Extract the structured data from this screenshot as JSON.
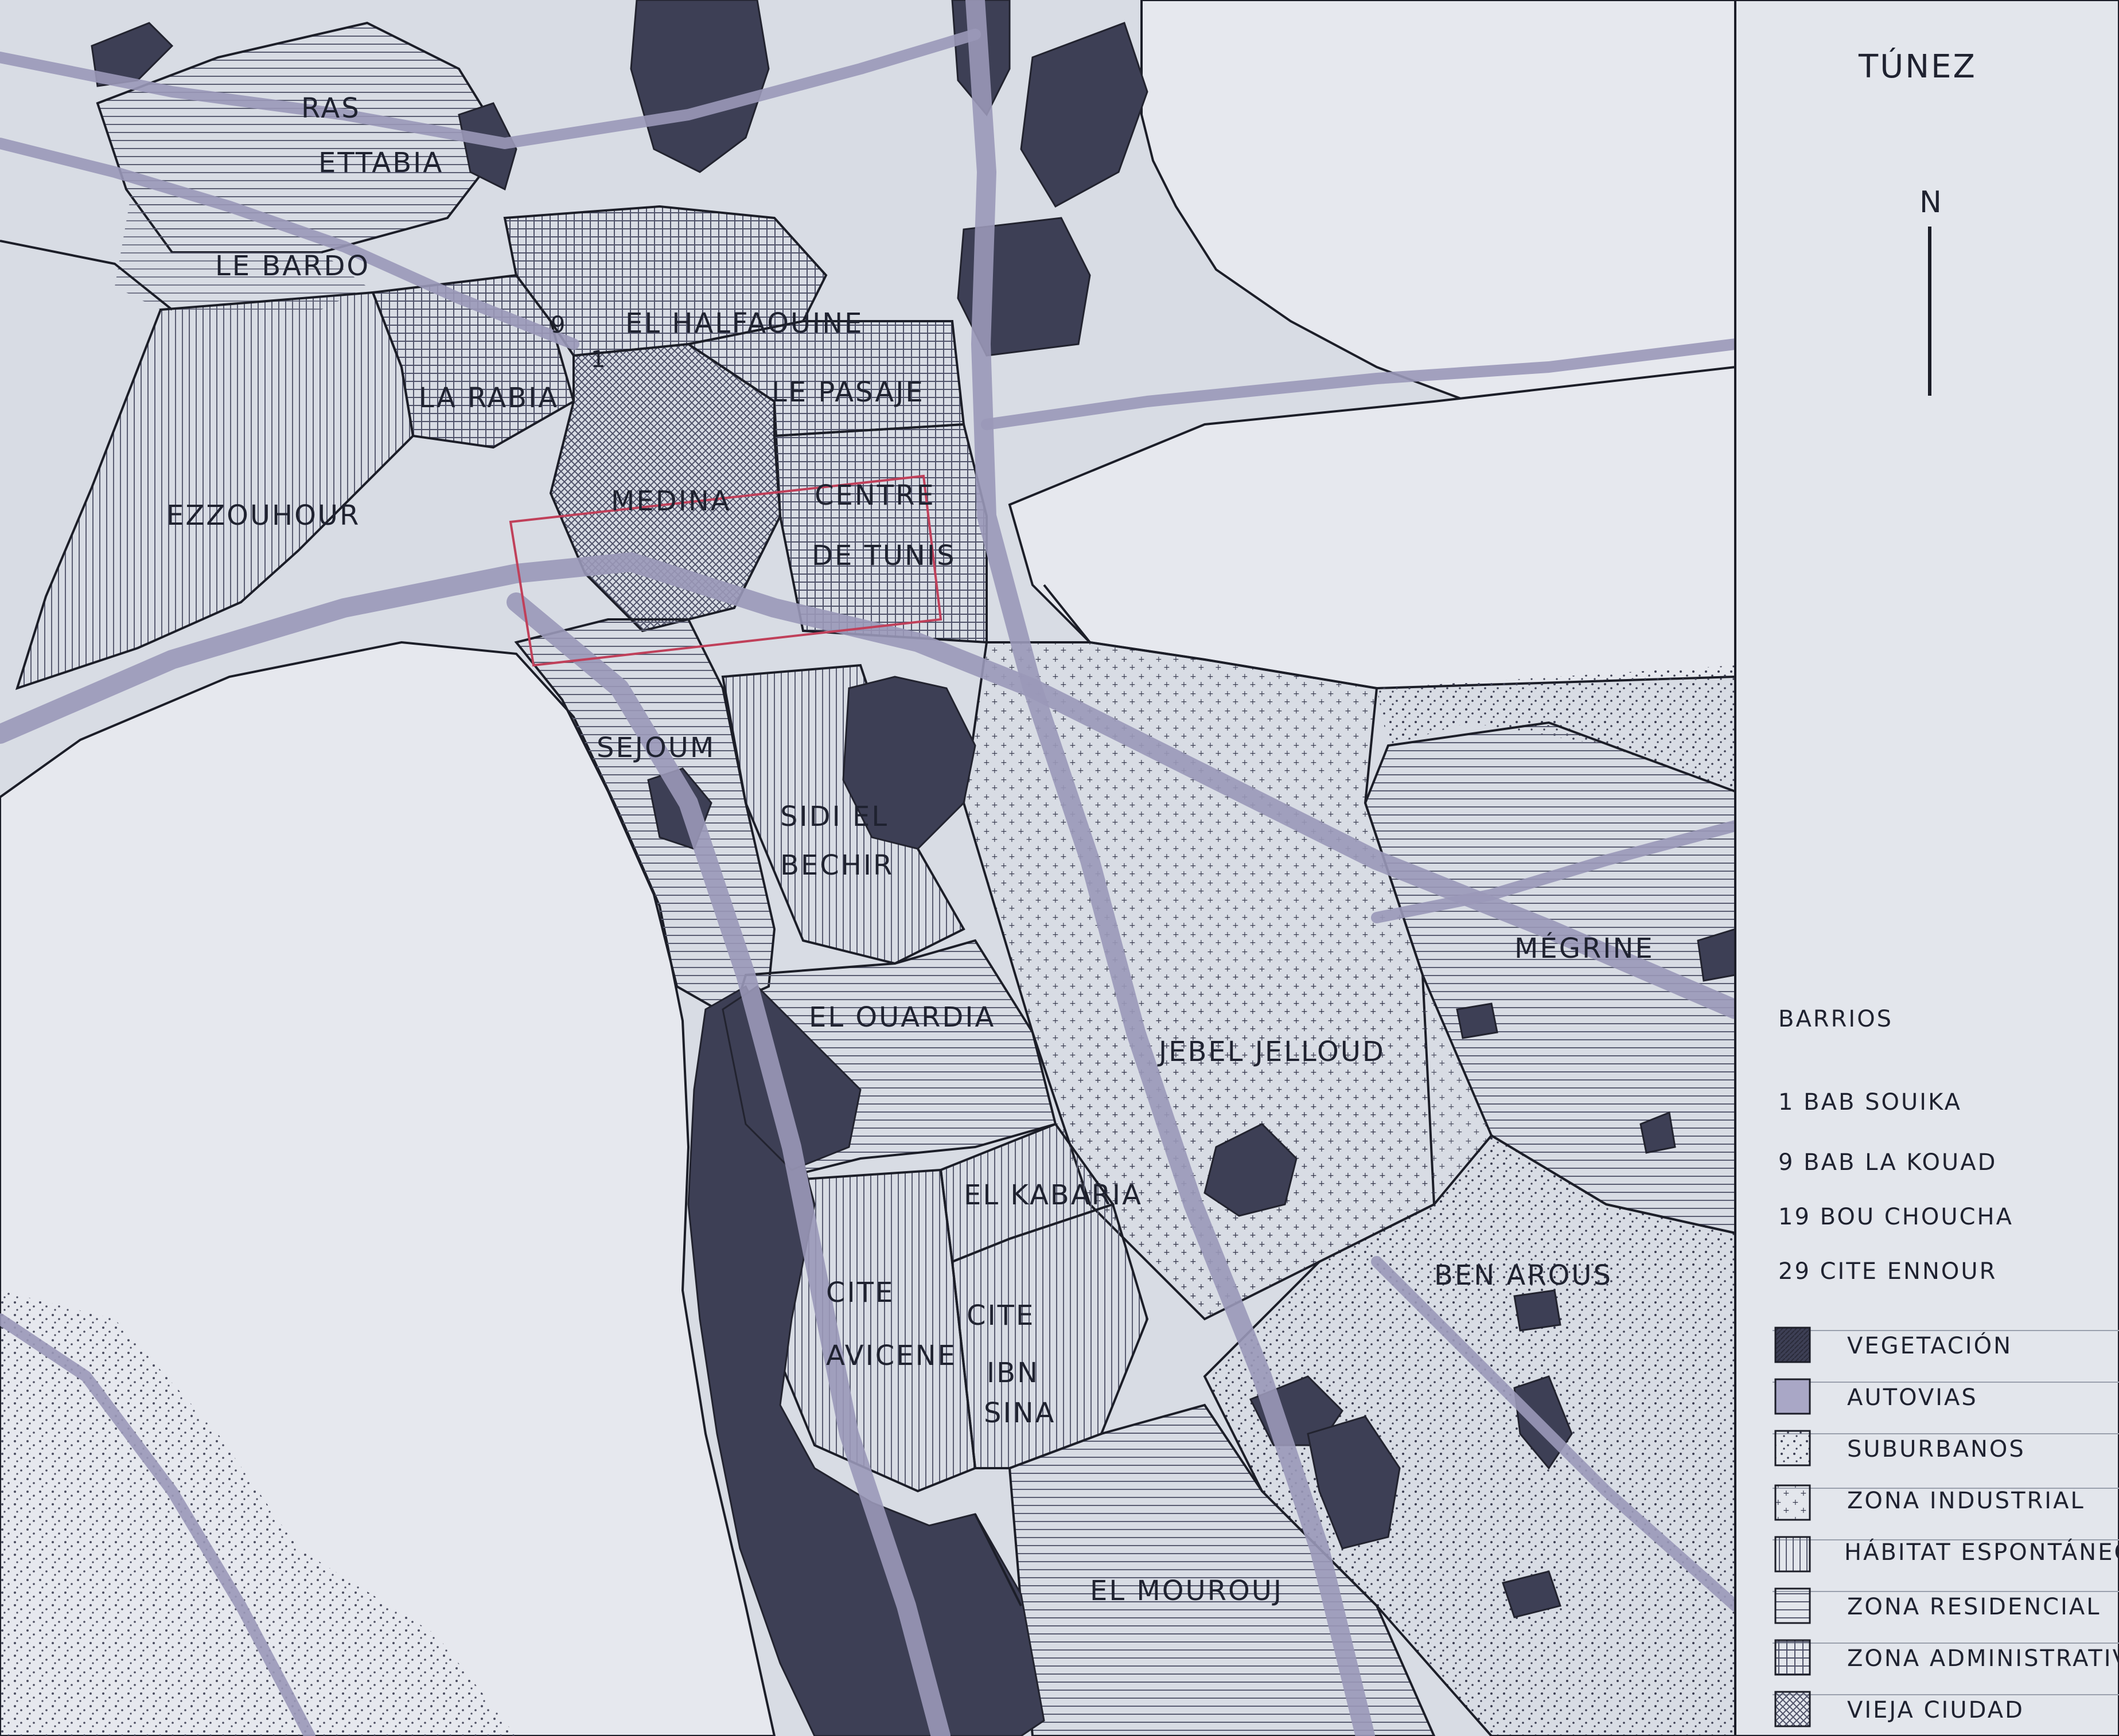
{
  "title": "TÚNEZ",
  "north_label": "N",
  "neighborhoods": {
    "ras_ettabia_1": "RAS",
    "ras_ettabia_2": "ETTABIA",
    "le_bardo": "LE BARDO",
    "el_halfaouine": "EL HALFAOUINE",
    "la_rabia": "LA RABIA",
    "le_pasaje": "LE PASAJE",
    "ezzouhour": "EZZOUHOUR",
    "medina": "MEDINA",
    "centre_1": "CENTRE",
    "centre_2": "DE TUNIS",
    "sejoum": "SEJOUM",
    "sidi_1": "SIDI EL",
    "sidi_2": "BECHIR",
    "megrine": "MÉGRINE",
    "el_ouardia": "EL OUARDIA",
    "jebel_jelloud": "JEBEL JELLOUD",
    "el_kabaria": "EL KABARIA",
    "ben_arous": "BEN AROUS",
    "cite_avicene_1": "CITE",
    "cite_avicene_2": "AVICENE",
    "cite_ibn_1": "CITE",
    "cite_ibn_2": "IBN",
    "cite_ibn_3": "SINA",
    "el_mourouj": "EL MOUROUJ",
    "marker_9": "9",
    "marker_1": "1"
  },
  "legend": {
    "barrios_title": "BARRIOS",
    "barrios": [
      "1 BAB SOUIKA",
      "9 BAB LA KOUAD",
      "19 BOU CHOUCHA",
      "29 CITE ENNOUR"
    ],
    "items": [
      {
        "label": "VEGETACIÓN",
        "pattern": "vegetation"
      },
      {
        "label": "AUTOVIAS",
        "pattern": "highways"
      },
      {
        "label": "SUBURBANOS",
        "pattern": "suburban"
      },
      {
        "label": "ZONA INDUSTRIAL",
        "pattern": "industrial"
      },
      {
        "label": "HÁBITAT ESPONTÁNEO",
        "pattern": "spontaneous"
      },
      {
        "label": "ZONA RESIDENCIAL",
        "pattern": "residential"
      },
      {
        "label": "ZONA ADMINISTRATIVA",
        "pattern": "administrative"
      },
      {
        "label": "VIEJA CIUDAD",
        "pattern": "old-city"
      }
    ]
  },
  "colors": {
    "background": "#dfe3ea",
    "water": "#e6e8ee",
    "vegetation": "#3d3f55",
    "highway": "#9a98b8",
    "line": "#1c1e28",
    "highlight": "#c0405a"
  }
}
